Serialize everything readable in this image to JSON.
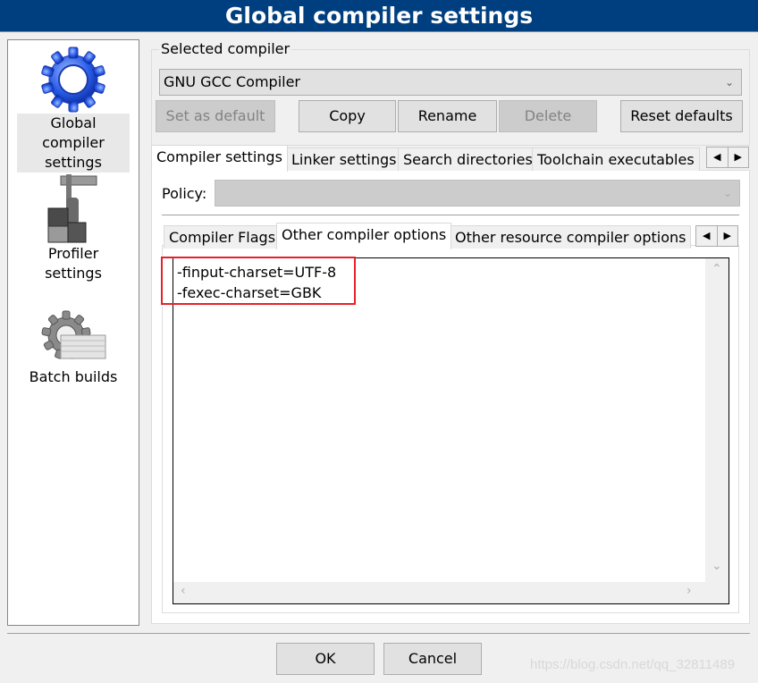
{
  "window": {
    "title": "Global compiler settings"
  },
  "sidebar": {
    "items": [
      {
        "label_line1": "Global compiler",
        "label_line2": "settings",
        "icon": "gear-icon",
        "selected": true
      },
      {
        "label": "Profiler settings",
        "icon": "caliper-blocks-icon",
        "selected": false
      },
      {
        "label": "Batch builds",
        "icon": "gear-stack-icon",
        "selected": false
      }
    ]
  },
  "compiler_group": {
    "title": "Selected compiler",
    "selected_compiler": "GNU GCC Compiler",
    "buttons": {
      "set_default": "Set as default",
      "copy": "Copy",
      "rename": "Rename",
      "delete": "Delete",
      "reset": "Reset defaults"
    }
  },
  "main_tabs": [
    "Compiler settings",
    "Linker settings",
    "Search directories",
    "Toolchain executables"
  ],
  "policy": {
    "label": "Policy:",
    "value": ""
  },
  "sub_tabs": [
    "Compiler Flags",
    "Other compiler options",
    "Other resource compiler options"
  ],
  "other_options": {
    "lines": [
      "-finput-charset=UTF-8",
      "-fexec-charset=GBK"
    ]
  },
  "dialog_buttons": {
    "ok": "OK",
    "cancel": "Cancel"
  },
  "watermark": "https://blog.csdn.net/qq_32811489"
}
